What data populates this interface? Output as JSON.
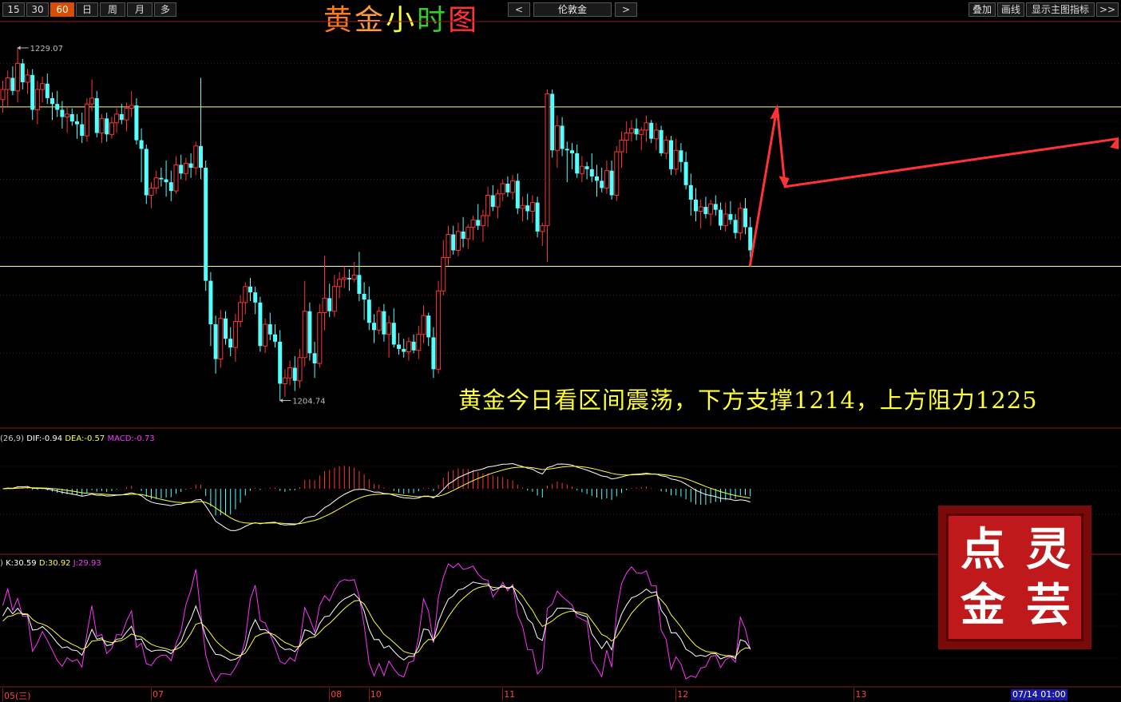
{
  "toolbar": {
    "periods": [
      {
        "label": "15",
        "active": false
      },
      {
        "label": "30",
        "active": false
      },
      {
        "label": "60",
        "active": true
      },
      {
        "label": "日",
        "active": false
      },
      {
        "label": "周",
        "active": false
      },
      {
        "label": "月",
        "active": false
      },
      {
        "label": "多",
        "active": false
      }
    ],
    "title_chars": [
      "黄",
      "金",
      "小",
      "时",
      "图"
    ],
    "prev_label": "<",
    "next_label": ">",
    "symbol": "伦敦金",
    "right_buttons": [
      "叠加",
      "画线",
      "显示主图指标",
      ">>"
    ]
  },
  "colors": {
    "up": "#ff3333",
    "down": "#54ffff",
    "level_line": "#ffff66",
    "dif": "#ffffff",
    "dea": "#ffff33",
    "macd": "#ff33ff",
    "k": "#ffffff",
    "d": "#ffff33",
    "j": "#ff33ff",
    "arrow": "#ff3333"
  },
  "chart_data": {
    "type": "candlestick",
    "title": "黄金小时图",
    "symbol": "伦敦金",
    "timeframe": "60",
    "price_high_label": "1229.07",
    "price_low_label": "1204.74",
    "ylim": [
      1203.5,
      1230.5
    ],
    "resistance": 1225,
    "support": 1214,
    "annotation": "黄金今日看区间震荡，下方支撑1214，上方阻力1225",
    "date_labels": [
      {
        "label": "05(三)",
        "index": 0
      },
      {
        "label": "07",
        "index": 30
      },
      {
        "label": "08",
        "index": 66
      },
      {
        "label": "10",
        "index": 74
      },
      {
        "label": "11",
        "index": 101
      },
      {
        "label": "12",
        "index": 136
      },
      {
        "label": "13",
        "index": 172
      },
      {
        "label": "14",
        "index": 208
      }
    ],
    "cursor_time": "07/14 01:00",
    "candles": [
      [
        1225.5,
        1226.8,
        1224.6,
        1226.2
      ],
      [
        1226.2,
        1227.5,
        1225.0,
        1227.0
      ],
      [
        1227.0,
        1227.8,
        1225.8,
        1226.1
      ],
      [
        1226.1,
        1229.07,
        1225.3,
        1228.0
      ],
      [
        1228.0,
        1228.3,
        1226.2,
        1226.7
      ],
      [
        1226.7,
        1227.6,
        1225.9,
        1227.2
      ],
      [
        1227.2,
        1227.6,
        1224.1,
        1224.8
      ],
      [
        1224.8,
        1226.8,
        1223.8,
        1226.2
      ],
      [
        1226.2,
        1227.1,
        1225.3,
        1226.6
      ],
      [
        1226.6,
        1227.3,
        1225.2,
        1225.6
      ],
      [
        1225.6,
        1226.0,
        1224.1,
        1225.2
      ],
      [
        1225.2,
        1226.1,
        1224.3,
        1224.8
      ],
      [
        1224.8,
        1225.4,
        1223.5,
        1224.3
      ],
      [
        1224.3,
        1225.0,
        1223.2,
        1224.5
      ],
      [
        1224.5,
        1224.9,
        1223.7,
        1224.0
      ],
      [
        1224.0,
        1224.5,
        1222.8,
        1223.8
      ],
      [
        1223.8,
        1224.6,
        1222.5,
        1223.0
      ],
      [
        1223.0,
        1225.6,
        1222.6,
        1225.2
      ],
      [
        1225.2,
        1226.9,
        1224.7,
        1225.6
      ],
      [
        1225.6,
        1226.1,
        1222.9,
        1223.2
      ],
      [
        1223.2,
        1224.5,
        1222.5,
        1224.2
      ],
      [
        1224.2,
        1224.6,
        1222.6,
        1223.1
      ],
      [
        1223.1,
        1224.3,
        1222.8,
        1223.9
      ],
      [
        1223.9,
        1224.9,
        1223.2,
        1224.5
      ],
      [
        1224.5,
        1225.2,
        1223.8,
        1224.1
      ],
      [
        1224.1,
        1225.3,
        1223.3,
        1224.9
      ],
      [
        1224.9,
        1226.1,
        1224.3,
        1225.1
      ],
      [
        1225.1,
        1225.6,
        1222.4,
        1222.7
      ],
      [
        1222.7,
        1223.5,
        1219.8,
        1222.1
      ],
      [
        1222.1,
        1222.4,
        1218.3,
        1218.9
      ],
      [
        1218.9,
        1219.8,
        1218.0,
        1219.4
      ],
      [
        1219.4,
        1220.6,
        1219.0,
        1220.1
      ],
      [
        1220.1,
        1220.8,
        1219.5,
        1220.0
      ],
      [
        1220.0,
        1221.3,
        1218.8,
        1219.8
      ],
      [
        1219.8,
        1220.6,
        1218.5,
        1219.2
      ],
      [
        1219.2,
        1221.6,
        1219.0,
        1221.0
      ],
      [
        1221.0,
        1221.7,
        1220.0,
        1220.4
      ],
      [
        1220.4,
        1221.5,
        1219.9,
        1221.1
      ],
      [
        1221.1,
        1221.8,
        1220.1,
        1220.8
      ],
      [
        1220.8,
        1222.6,
        1220.3,
        1222.3
      ],
      [
        1222.3,
        1227.0,
        1220.0,
        1220.8
      ],
      [
        1220.8,
        1221.3,
        1212.3,
        1213.0
      ],
      [
        1213.0,
        1213.6,
        1208.5,
        1210.0
      ],
      [
        1210.0,
        1210.6,
        1206.6,
        1207.6
      ],
      [
        1207.6,
        1211.0,
        1207.0,
        1210.4
      ],
      [
        1210.4,
        1210.9,
        1208.6,
        1209.0
      ],
      [
        1209.0,
        1209.8,
        1207.8,
        1208.4
      ],
      [
        1208.4,
        1210.7,
        1207.4,
        1210.2
      ],
      [
        1210.2,
        1212.0,
        1209.8,
        1211.5
      ],
      [
        1211.5,
        1212.9,
        1210.7,
        1212.6
      ],
      [
        1212.6,
        1213.2,
        1211.6,
        1212.2
      ],
      [
        1212.2,
        1212.6,
        1210.7,
        1211.5
      ],
      [
        1211.5,
        1211.9,
        1208.1,
        1208.5
      ],
      [
        1208.5,
        1210.4,
        1208.0,
        1210.0
      ],
      [
        1210.0,
        1210.8,
        1208.9,
        1209.3
      ],
      [
        1209.3,
        1210.0,
        1208.4,
        1208.8
      ],
      [
        1208.8,
        1209.6,
        1204.74,
        1205.9
      ],
      [
        1205.9,
        1206.9,
        1205.0,
        1206.3
      ],
      [
        1206.3,
        1207.5,
        1205.8,
        1207.0
      ],
      [
        1207.0,
        1207.8,
        1205.4,
        1206.1
      ],
      [
        1206.1,
        1208.3,
        1205.6,
        1207.7
      ],
      [
        1207.7,
        1213.0,
        1207.1,
        1210.9
      ],
      [
        1210.9,
        1211.5,
        1207.5,
        1208.0
      ],
      [
        1208.0,
        1208.8,
        1206.3,
        1207.3
      ],
      [
        1207.3,
        1211.4,
        1207.0,
        1210.8
      ],
      [
        1210.8,
        1214.7,
        1209.6,
        1211.8
      ],
      [
        1211.8,
        1212.8,
        1210.5,
        1210.9
      ],
      [
        1210.9,
        1213.4,
        1210.5,
        1212.6
      ],
      [
        1212.6,
        1213.6,
        1211.8,
        1213.1
      ],
      [
        1213.1,
        1214.0,
        1212.5,
        1213.2
      ],
      [
        1213.2,
        1213.8,
        1212.3,
        1213.1
      ],
      [
        1213.1,
        1214.3,
        1212.9,
        1213.4
      ],
      [
        1213.4,
        1215.0,
        1211.6,
        1212.1
      ],
      [
        1212.1,
        1212.9,
        1210.3,
        1211.7
      ],
      [
        1211.7,
        1212.6,
        1209.6,
        1210.1
      ],
      [
        1210.1,
        1210.7,
        1208.7,
        1209.6
      ],
      [
        1209.6,
        1211.2,
        1209.3,
        1210.9
      ],
      [
        1210.9,
        1211.4,
        1208.8,
        1209.3
      ],
      [
        1209.3,
        1210.6,
        1207.7,
        1210.1
      ],
      [
        1210.1,
        1211.1,
        1208.4,
        1208.6
      ],
      [
        1208.6,
        1209.4,
        1207.9,
        1208.3
      ],
      [
        1208.3,
        1209.0,
        1207.7,
        1208.1
      ],
      [
        1208.1,
        1209.1,
        1207.5,
        1208.8
      ],
      [
        1208.8,
        1209.3,
        1208.0,
        1208.2
      ],
      [
        1208.2,
        1209.9,
        1207.6,
        1209.3
      ],
      [
        1209.3,
        1211.3,
        1208.7,
        1210.6
      ],
      [
        1210.6,
        1210.8,
        1208.5,
        1209.1
      ],
      [
        1209.1,
        1209.8,
        1206.3,
        1206.9
      ],
      [
        1206.9,
        1213.0,
        1206.6,
        1212.3
      ],
      [
        1212.3,
        1215.8,
        1212.0,
        1214.6
      ],
      [
        1214.6,
        1216.8,
        1214.0,
        1216.2
      ],
      [
        1216.2,
        1216.8,
        1214.8,
        1215.1
      ],
      [
        1215.1,
        1217.0,
        1214.7,
        1216.4
      ],
      [
        1216.4,
        1217.4,
        1215.3,
        1215.9
      ],
      [
        1215.9,
        1216.9,
        1215.2,
        1216.7
      ],
      [
        1216.7,
        1217.5,
        1215.8,
        1217.2
      ],
      [
        1217.2,
        1218.3,
        1216.5,
        1216.8
      ],
      [
        1216.8,
        1217.9,
        1215.7,
        1217.5
      ],
      [
        1217.5,
        1219.5,
        1216.7,
        1218.9
      ],
      [
        1218.9,
        1219.6,
        1217.8,
        1218.1
      ],
      [
        1218.1,
        1219.3,
        1217.3,
        1219.0
      ],
      [
        1219.0,
        1220.0,
        1218.5,
        1219.7
      ],
      [
        1219.7,
        1220.2,
        1218.8,
        1219.1
      ],
      [
        1219.1,
        1220.3,
        1218.6,
        1219.9
      ],
      [
        1219.9,
        1220.4,
        1217.6,
        1218.0
      ],
      [
        1218.0,
        1218.8,
        1217.1,
        1218.2
      ],
      [
        1218.2,
        1219.0,
        1217.2,
        1217.8
      ],
      [
        1217.8,
        1218.9,
        1217.0,
        1218.4
      ],
      [
        1218.4,
        1218.8,
        1216.0,
        1216.4
      ],
      [
        1216.4,
        1217.0,
        1215.4,
        1216.8
      ],
      [
        1216.8,
        1226.2,
        1214.3,
        1225.9
      ],
      [
        1225.9,
        1226.2,
        1221.5,
        1222.0
      ],
      [
        1222.0,
        1224.4,
        1220.8,
        1223.7
      ],
      [
        1223.7,
        1224.3,
        1221.6,
        1222.1
      ],
      [
        1222.1,
        1222.6,
        1219.8,
        1222.0
      ],
      [
        1222.0,
        1222.5,
        1220.7,
        1221.8
      ],
      [
        1221.8,
        1222.4,
        1220.1,
        1220.4
      ],
      [
        1220.4,
        1221.6,
        1219.8,
        1220.9
      ],
      [
        1220.9,
        1221.2,
        1220.0,
        1220.7
      ],
      [
        1220.7,
        1221.8,
        1219.8,
        1220.2
      ],
      [
        1220.2,
        1221.0,
        1218.8,
        1219.9
      ],
      [
        1219.9,
        1220.8,
        1219.1,
        1219.4
      ],
      [
        1219.4,
        1221.3,
        1219.0,
        1220.6
      ],
      [
        1220.6,
        1221.3,
        1218.6,
        1218.9
      ],
      [
        1218.9,
        1222.3,
        1218.5,
        1221.9
      ],
      [
        1221.9,
        1223.3,
        1220.8,
        1222.7
      ],
      [
        1222.7,
        1224.0,
        1221.8,
        1223.2
      ],
      [
        1223.2,
        1224.1,
        1222.6,
        1223.5
      ],
      [
        1223.5,
        1224.2,
        1222.7,
        1223.1
      ],
      [
        1223.1,
        1223.6,
        1222.0,
        1223.4
      ],
      [
        1223.4,
        1224.4,
        1222.6,
        1223.9
      ],
      [
        1223.9,
        1224.1,
        1222.5,
        1222.8
      ],
      [
        1222.8,
        1223.9,
        1222.0,
        1223.4
      ],
      [
        1223.4,
        1223.7,
        1221.6,
        1221.8
      ],
      [
        1221.8,
        1223.0,
        1221.4,
        1222.7
      ],
      [
        1222.7,
        1223.0,
        1220.3,
        1220.7
      ],
      [
        1220.7,
        1222.8,
        1220.3,
        1222.0
      ],
      [
        1222.0,
        1222.5,
        1220.5,
        1221.2
      ],
      [
        1221.2,
        1221.9,
        1219.3,
        1219.6
      ],
      [
        1219.6,
        1220.4,
        1217.5,
        1218.6
      ],
      [
        1218.6,
        1219.4,
        1217.1,
        1217.8
      ],
      [
        1217.8,
        1218.6,
        1216.6,
        1218.1
      ],
      [
        1218.1,
        1218.8,
        1217.3,
        1217.6
      ],
      [
        1217.6,
        1218.6,
        1216.8,
        1218.3
      ],
      [
        1218.3,
        1218.9,
        1217.5,
        1217.9
      ],
      [
        1217.9,
        1218.4,
        1216.5,
        1216.8
      ],
      [
        1216.8,
        1218.4,
        1216.4,
        1217.6
      ],
      [
        1217.6,
        1218.5,
        1216.9,
        1217.2
      ],
      [
        1217.2,
        1217.6,
        1215.9,
        1216.3
      ],
      [
        1216.3,
        1218.4,
        1215.8,
        1218.0
      ],
      [
        1218.0,
        1218.7,
        1216.2,
        1216.7
      ],
      [
        1216.7,
        1217.4,
        1214.6,
        1215.1
      ]
    ]
  },
  "macd": {
    "params_text": "(26,9)",
    "dif_text": "DIF:-0.94",
    "dea_text": "DEA:-0.57",
    "macd_text": "MACD:-0.73"
  },
  "kdj": {
    "params_text": ")",
    "k_text": "K:30.59",
    "d_text": "D:30.92",
    "j_text": "J:29.93"
  },
  "stamp": {
    "chars": [
      "点",
      "灵",
      "金",
      "芸"
    ]
  }
}
